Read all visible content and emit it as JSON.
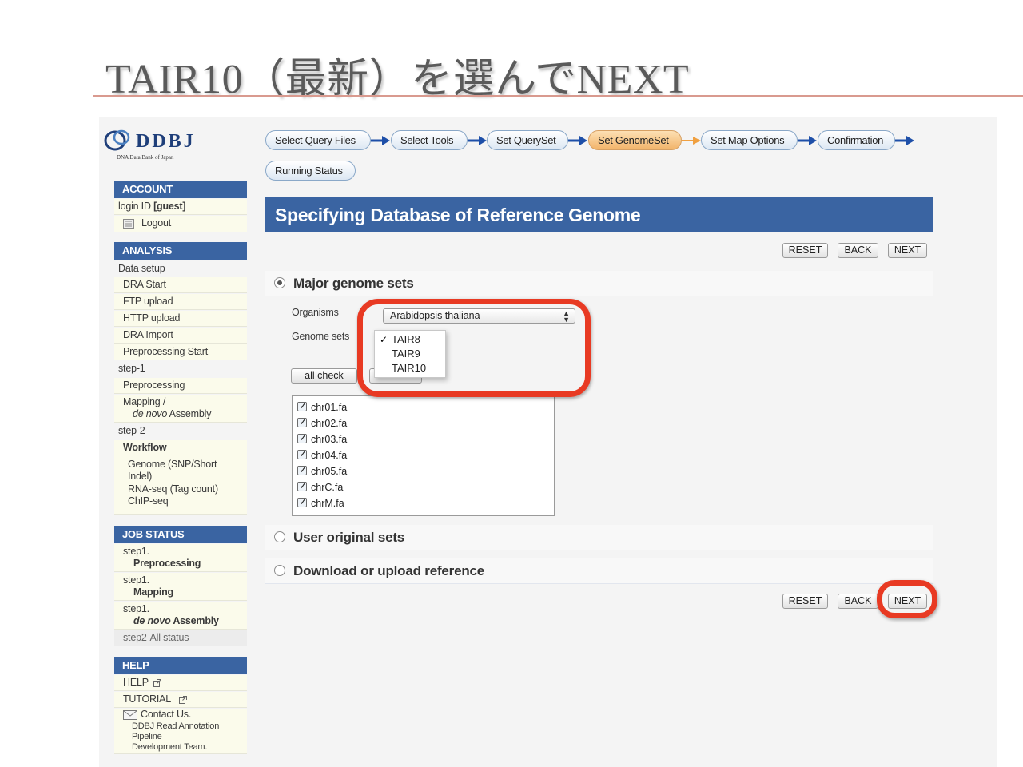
{
  "slide": {
    "title": "TAIR10（最新）を選んでNEXT"
  },
  "logo": {
    "text": "DDBJ",
    "subtitle": "DNA Data Bank of Japan"
  },
  "workflow": {
    "steps": [
      "Select Query Files",
      "Select Tools",
      "Set QuerySet",
      "Set GenomeSet",
      "Set Map Options",
      "Confirmation",
      "Running Status"
    ],
    "active_step": "Set GenomeSet"
  },
  "sidebar": {
    "account": {
      "heading": "ACCOUNT",
      "login_prefix": "login ID ",
      "login_user": "[guest]",
      "logout": "Logout"
    },
    "analysis": {
      "heading": "ANALYSIS",
      "data_setup_label": "Data setup",
      "data_setup_items": [
        "DRA Start",
        "FTP upload",
        "HTTP upload",
        "DRA Import",
        "Preprocessing Start"
      ],
      "step1_label": "step-1",
      "step1_items": [
        "Preprocessing",
        "Mapping /"
      ],
      "denovo": "de novo",
      "assembly": " Assembly",
      "step2_label": "step-2",
      "workflow_label": "Workflow",
      "workflow_items": [
        "Genome (SNP/Short",
        "Indel)",
        "RNA-seq (Tag count)",
        "ChIP-seq"
      ]
    },
    "job_status": {
      "heading": "JOB STATUS",
      "entries": [
        {
          "step": "step1.",
          "name": "Preprocessing"
        },
        {
          "step": "step1.",
          "name": "Mapping"
        },
        {
          "step": "step1.",
          "name_italic": "de novo",
          "name_rest": " Assembly"
        }
      ],
      "all_status": "step2-All status"
    },
    "help": {
      "heading": "HELP",
      "help_link": "HELP",
      "tutorial_link": "TUTORIAL",
      "contact": "Contact Us.",
      "team_lines": [
        "DDBJ Read Annotation",
        "Pipeline",
        "Development Team."
      ]
    }
  },
  "main": {
    "header": "Specifying Database of Reference Genome",
    "buttons": {
      "reset": "RESET",
      "back": "BACK",
      "next": "NEXT"
    },
    "major": {
      "label": "Major genome sets",
      "selected": true,
      "organisms_label": "Organisms",
      "organism_value": "Arabidopsis thaliana",
      "genome_sets_label": "Genome sets",
      "genome_options": [
        "TAIR8",
        "TAIR9",
        "TAIR10"
      ],
      "checked_option": "TAIR8",
      "all_check": "all check",
      "files": [
        "chr01.fa",
        "chr02.fa",
        "chr03.fa",
        "chr04.fa",
        "chr05.fa",
        "chrC.fa",
        "chrM.fa"
      ]
    },
    "user_original": {
      "label": "User original sets"
    },
    "download_upload": {
      "label": "Download or upload reference"
    }
  },
  "colors": {
    "header_blue": "#3a64a2",
    "active_step": "#f2b46a",
    "highlight_red": "#e83a23"
  },
  "icons": {
    "logout": "logout-icon",
    "external": "external-link-icon",
    "mail": "mail-icon"
  }
}
